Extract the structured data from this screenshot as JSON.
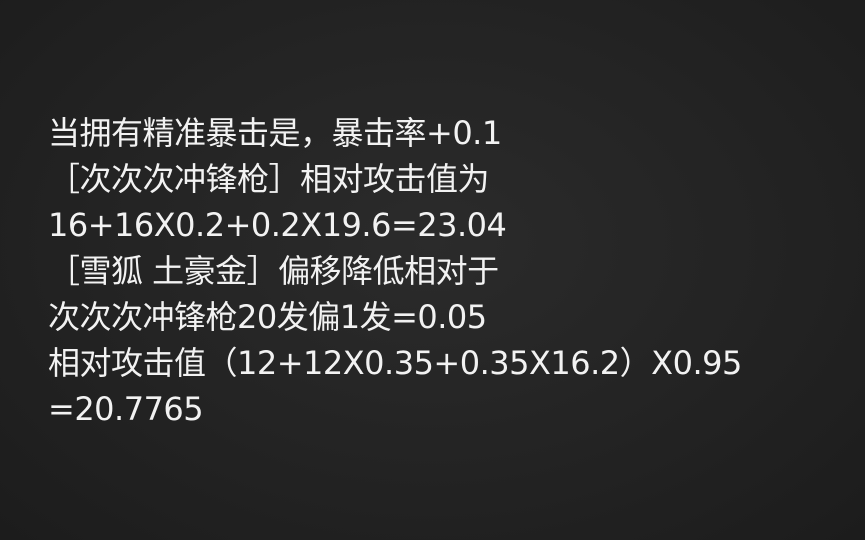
{
  "note": {
    "lines": [
      "当拥有精准暴击是，暴击率+0.1",
      "［次次次冲锋枪］相对攻击值为",
      "16+16X0.2+0.2X19.6=23.04",
      "［雪狐 土豪金］偏移降低相对于",
      "次次次冲锋枪20发偏1发=0.05",
      "相对攻击值（12+12X0.35+0.35X16.2）X0.95",
      "=20.7765"
    ]
  }
}
